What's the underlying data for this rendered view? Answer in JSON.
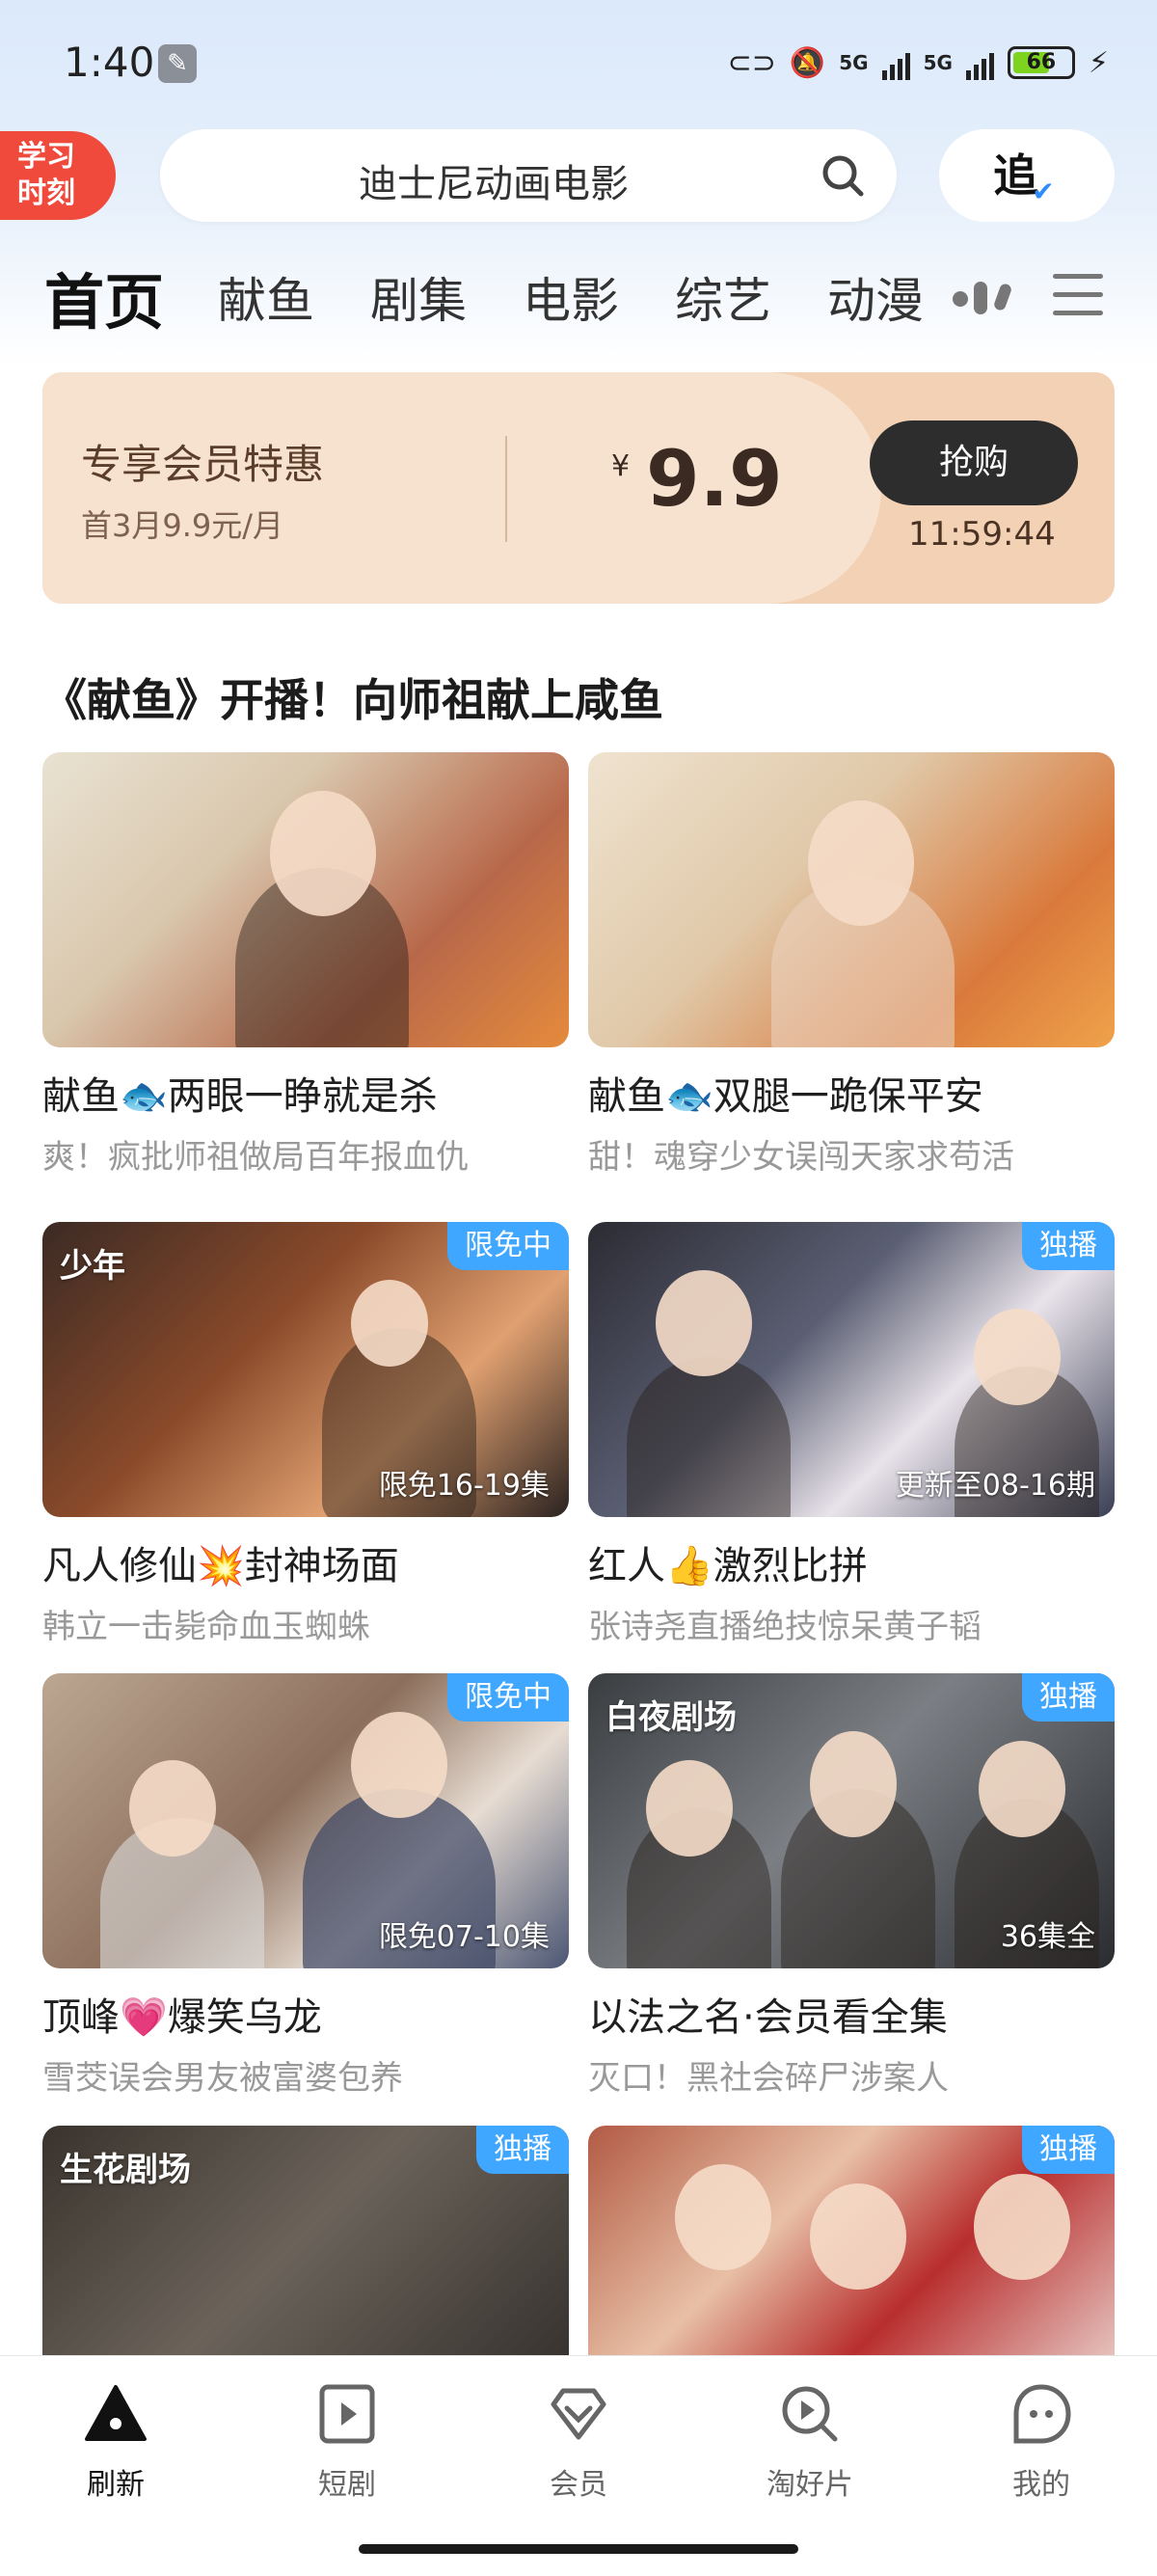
{
  "status_bar": {
    "time": "1:40",
    "signal1": "5G",
    "signal2": "5G",
    "battery": "66"
  },
  "header": {
    "study_badge": "学习\n时刻",
    "study_line1": "学习",
    "study_line2": "时刻",
    "search_text": "迪士尼动画电影",
    "follow_label": "追"
  },
  "tabs": [
    "首页",
    "献鱼",
    "剧集",
    "电影",
    "综艺",
    "动漫"
  ],
  "promo": {
    "title": "专享会员特惠",
    "subtitle": "首3月9.9元/月",
    "currency": "¥",
    "price": "9.9",
    "buy_label": "抢购",
    "countdown": "11:59:44"
  },
  "section": {
    "title": "《献鱼》开播！向师祖献上咸鱼"
  },
  "cards": [
    {
      "title": "献鱼🐟两眼一睁就是杀",
      "subtitle": "爽！疯批师祖做局百年报血仇",
      "tag": "",
      "note": "",
      "logo": ""
    },
    {
      "title": "献鱼🐟双腿一跪保平安",
      "subtitle": "甜！魂穿少女误闯天家求苟活",
      "tag": "",
      "note": "",
      "logo": ""
    },
    {
      "title": "凡人修仙💥封神场面",
      "subtitle": "韩立一击毙命血玉蜘蛛",
      "tag": "限免中",
      "note": "限免16-19集",
      "logo": "少年"
    },
    {
      "title": "红人👍激烈比拼",
      "subtitle": "张诗尧直播绝技惊呆黄子韬",
      "tag": "独播",
      "note": "更新至08-16期",
      "logo": ""
    },
    {
      "title": "顶峰💗爆笑乌龙",
      "subtitle": "雪茭误会男友被富婆包养",
      "tag": "限免中",
      "note": "限免07-10集",
      "logo": ""
    },
    {
      "title": "以法之名·会员看全集",
      "subtitle": "灭口！黑社会碎尸涉案人",
      "tag": "独播",
      "note": "36集全",
      "logo": "白夜剧场"
    },
    {
      "title": "",
      "subtitle": "",
      "tag": "独播",
      "note": "",
      "logo": "生花剧场"
    },
    {
      "title": "",
      "subtitle": "",
      "tag": "独播",
      "note": "",
      "logo": ""
    }
  ],
  "bottom_nav": [
    {
      "label": "刷新",
      "icon": "home-triangle-icon"
    },
    {
      "label": "短剧",
      "icon": "play-square-icon"
    },
    {
      "label": "会员",
      "icon": "vip-diamond-icon"
    },
    {
      "label": "淘好片",
      "icon": "search-play-icon"
    },
    {
      "label": "我的",
      "icon": "profile-bubble-icon"
    }
  ],
  "colors": {
    "accent_blue": "#3fa7ff",
    "promo_bg": "#f2d1b4",
    "badge_red": "#f04a3c"
  }
}
